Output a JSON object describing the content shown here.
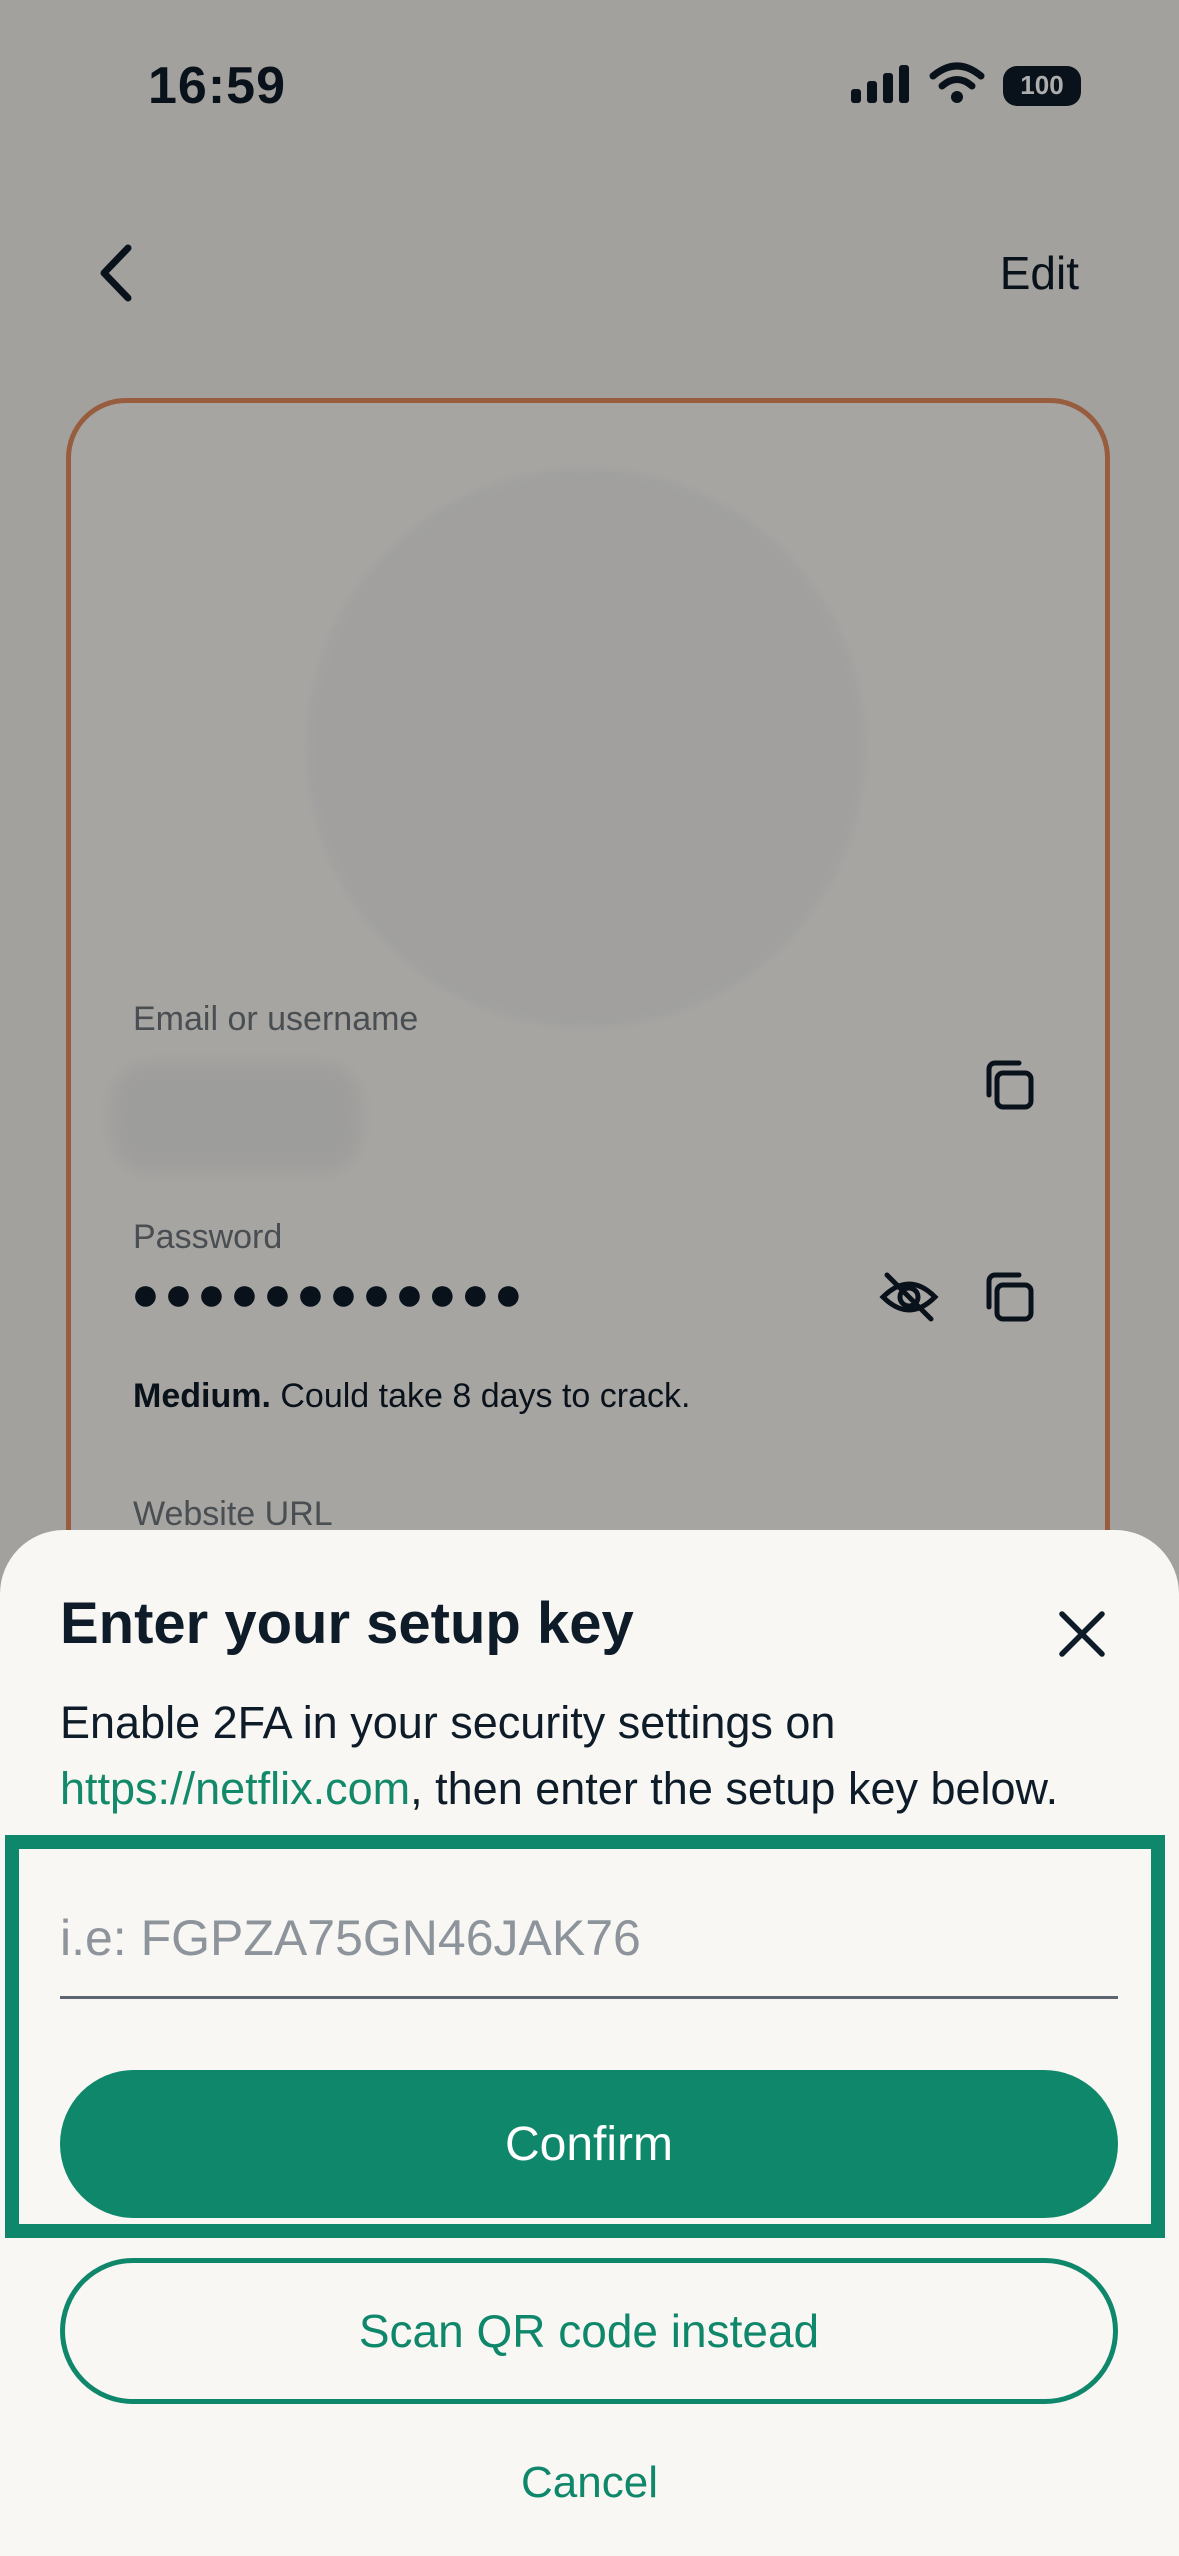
{
  "status_bar": {
    "time": "16:59",
    "battery": "100",
    "icons": [
      "cellular-signal-icon",
      "wifi-icon",
      "battery-icon"
    ]
  },
  "header": {
    "back_icon": "chevron-left-icon",
    "edit_label": "Edit"
  },
  "card": {
    "email_label": "Email or username",
    "password_label": "Password",
    "password_masked": "●●●●●●●●●●●●",
    "strength_level": "Medium.",
    "strength_text": " Could take 8 days to crack.",
    "website_label": "Website URL",
    "icons": [
      "copy-icon",
      "eye-off-icon"
    ]
  },
  "sheet": {
    "title": "Enter your setup key",
    "desc_prefix": "Enable 2FA in your security settings on ",
    "desc_link": "https://netflix.com",
    "desc_suffix": ", then enter the setup key below.",
    "input_placeholder": "i.e: FGPZA75GN46JAK76",
    "input_value": "",
    "confirm_label": "Confirm",
    "scan_label": "Scan QR code instead",
    "cancel_label": "Cancel",
    "close_icon": "close-icon"
  },
  "colors": {
    "accent": "#0f876b",
    "card_border": "#e08a5c",
    "text": "#0e1b28"
  }
}
